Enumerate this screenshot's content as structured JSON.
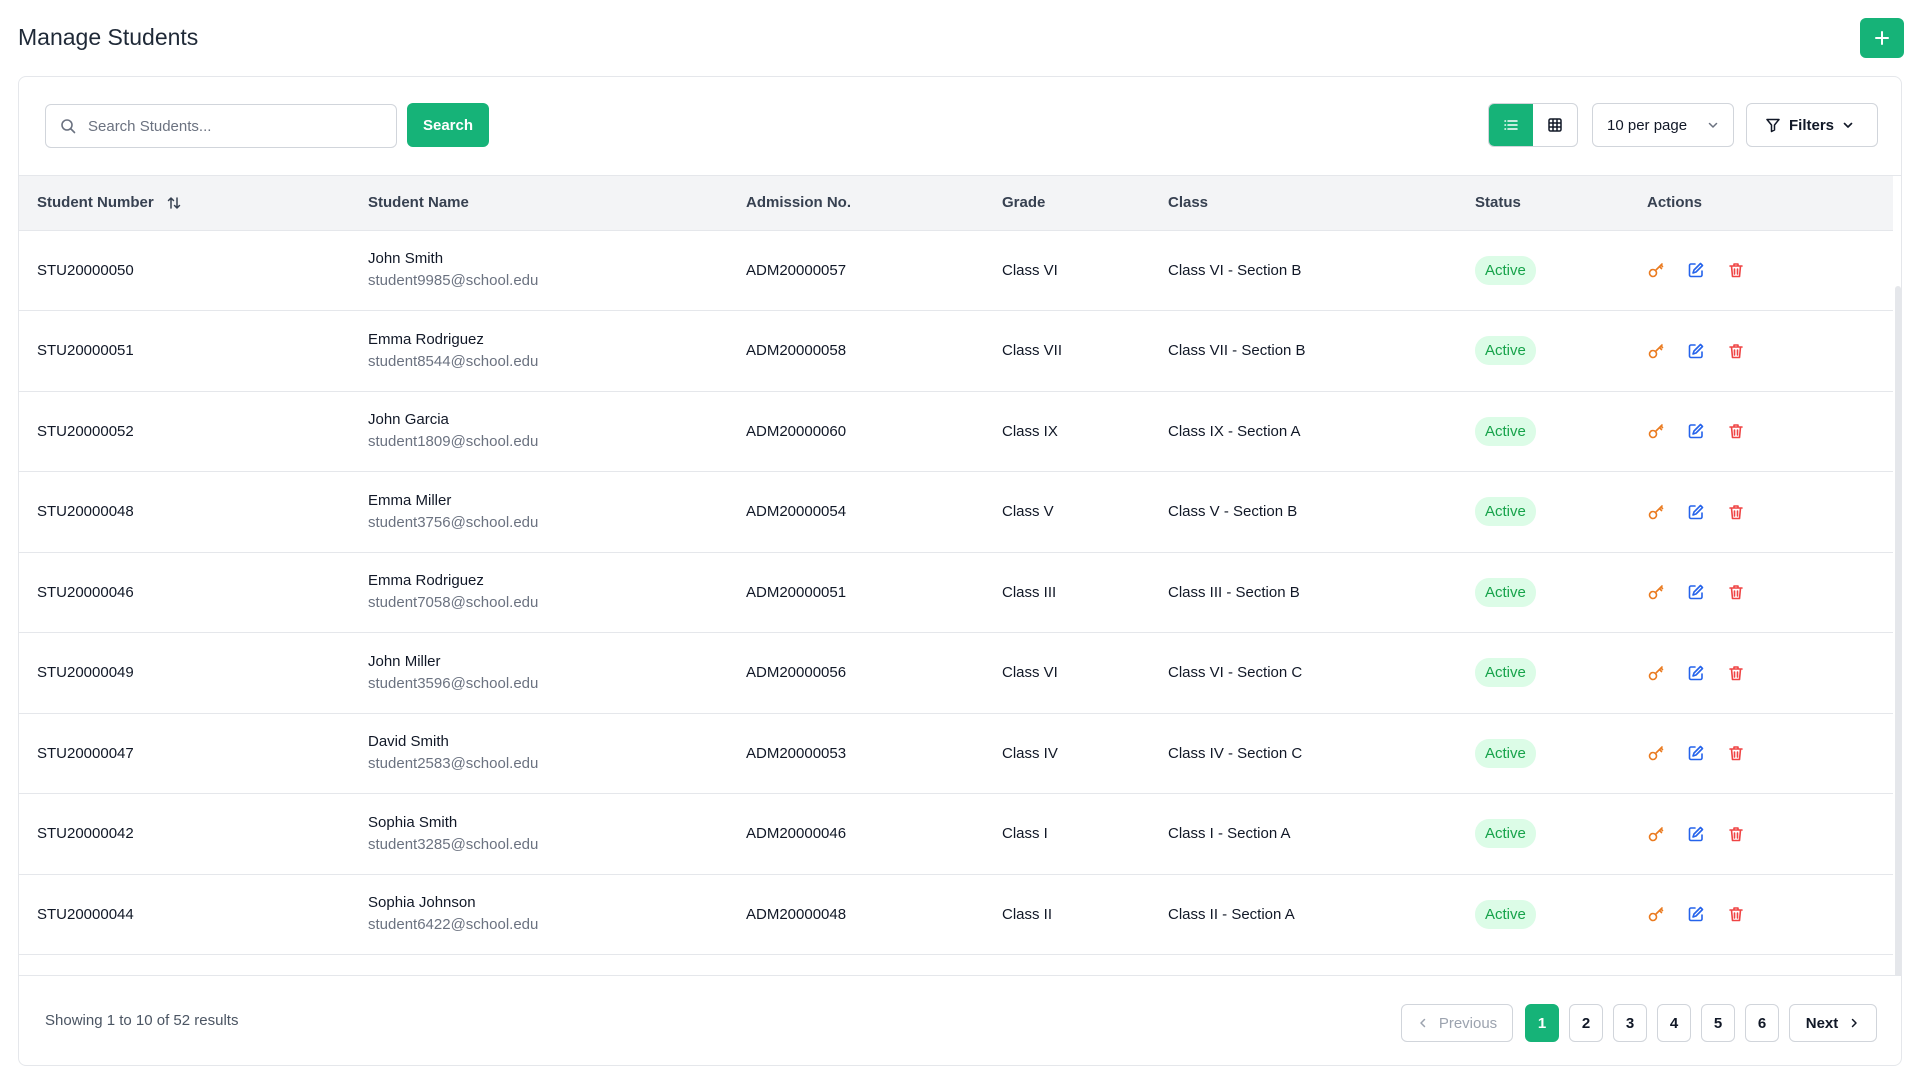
{
  "header": {
    "title": "Manage Students",
    "add_label": "+"
  },
  "toolbar": {
    "search_placeholder": "Search Students...",
    "search_button": "Search",
    "per_page": "10 per page",
    "filters_label": "Filters"
  },
  "table": {
    "columns": [
      "Student Number",
      "Student Name",
      "Admission No.",
      "Grade",
      "Class",
      "Status",
      "Actions"
    ],
    "rows": [
      {
        "number": "STU20000050",
        "name": "John Smith",
        "email": "student9985@school.edu",
        "admission": "ADM20000057",
        "grade": "Class VI",
        "class": "Class VI - Section B",
        "status": "Active"
      },
      {
        "number": "STU20000051",
        "name": "Emma Rodriguez",
        "email": "student8544@school.edu",
        "admission": "ADM20000058",
        "grade": "Class VII",
        "class": "Class VII - Section B",
        "status": "Active"
      },
      {
        "number": "STU20000052",
        "name": "John Garcia",
        "email": "student1809@school.edu",
        "admission": "ADM20000060",
        "grade": "Class IX",
        "class": "Class IX - Section A",
        "status": "Active"
      },
      {
        "number": "STU20000048",
        "name": "Emma Miller",
        "email": "student3756@school.edu",
        "admission": "ADM20000054",
        "grade": "Class V",
        "class": "Class V - Section B",
        "status": "Active"
      },
      {
        "number": "STU20000046",
        "name": "Emma Rodriguez",
        "email": "student7058@school.edu",
        "admission": "ADM20000051",
        "grade": "Class III",
        "class": "Class III - Section B",
        "status": "Active"
      },
      {
        "number": "STU20000049",
        "name": "John Miller",
        "email": "student3596@school.edu",
        "admission": "ADM20000056",
        "grade": "Class VI",
        "class": "Class VI - Section C",
        "status": "Active"
      },
      {
        "number": "STU20000047",
        "name": "David Smith",
        "email": "student2583@school.edu",
        "admission": "ADM20000053",
        "grade": "Class IV",
        "class": "Class IV - Section C",
        "status": "Active"
      },
      {
        "number": "STU20000042",
        "name": "Sophia Smith",
        "email": "student3285@school.edu",
        "admission": "ADM20000046",
        "grade": "Class I",
        "class": "Class I - Section A",
        "status": "Active"
      },
      {
        "number": "STU20000044",
        "name": "Sophia Johnson",
        "email": "student6422@school.edu",
        "admission": "ADM20000048",
        "grade": "Class II",
        "class": "Class II - Section A",
        "status": "Active"
      }
    ]
  },
  "footer": {
    "results_text": "Showing 1 to 10 of 52 results",
    "previous_label": "Previous",
    "next_label": "Next",
    "pages": [
      "1",
      "2",
      "3",
      "4",
      "5",
      "6"
    ],
    "current_page": "1"
  },
  "colors": {
    "accent": "#16b378",
    "key_icon": "#ea7a1f",
    "edit_icon": "#2563eb",
    "delete_icon": "#ef4444",
    "status_bg": "#dcfce7",
    "status_text": "#16a34a"
  },
  "icons": {
    "add": "plus-icon",
    "search": "search-icon",
    "list_view": "list-icon",
    "grid_view": "grid-icon",
    "per_page": "chevron-down-icon",
    "filters": "filter-icon",
    "sort": "sort-icon",
    "key": "key-icon",
    "edit": "edit-icon",
    "delete": "trash-icon"
  }
}
